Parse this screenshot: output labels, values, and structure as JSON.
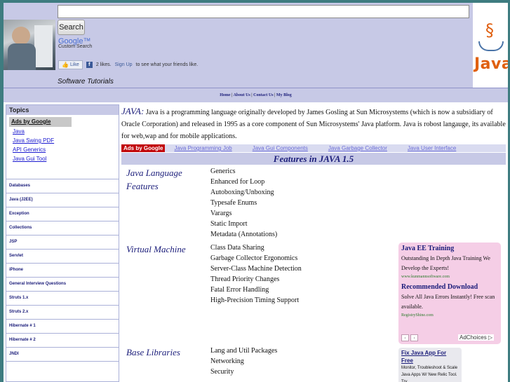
{
  "header": {
    "search_placeholder": "",
    "search_button": "Search",
    "google_brand": "Google™",
    "custom_search": "Custom Search",
    "fb_like": "Like",
    "fb_likes_text": "2 likes.",
    "fb_signup": "Sign Up",
    "fb_suffix": "to see what your friends like.",
    "tagline": "Software Tutorials",
    "logo_text": "Java"
  },
  "nav": {
    "home": "Home",
    "about": "About Us",
    "contact": "Contact Us",
    "blog": "My Blog",
    "sep": "|"
  },
  "sidebar": {
    "heading": "Topics",
    "ads_label": "Ads by Google",
    "ad_links": [
      "Java",
      "Java Swing PDF",
      "API Generics",
      "Java Gui Tool"
    ],
    "items": [
      "Databases",
      "Java (J2EE)",
      "Exception",
      "Collections",
      "JSP",
      "Servlet",
      "iPhone",
      "General Interview Questions",
      "Struts 1.x",
      "Struts 2.x",
      "Hibernate # 1",
      "Hibernate # 2",
      "JNDI"
    ]
  },
  "intro": {
    "java_label": "JAVA:",
    "text": " Java is a programming language originally developed by James Gosling at Sun Microsystems (which is now a subsidiary of Oracle Corporation) and released in 1995 as a core component of Sun Microsystems' Java platform. Java is robost langauge, its available for web,wap and for mobile applications."
  },
  "ad_strip": {
    "badge": "Ads by Google",
    "links": [
      "Java Programming Job",
      "Java Gui Components",
      "Java Garbage Collector",
      "Java User Interface"
    ]
  },
  "features_title": "Features in JAVA 1.5",
  "sections": [
    {
      "title": "Java Language Features",
      "items": [
        "Generics",
        "Enhanced for Loop",
        "Autoboxing/Unboxing",
        "Typesafe Enums",
        "Varargs",
        "Static Import",
        "Metadata (Annotations)"
      ]
    },
    {
      "title": "Virtual Machine",
      "items": [
        "Class Data Sharing",
        "Garbage Collector Ergonomics",
        "Server-Class Machine Detection",
        "Thread Priority Changes",
        "Fatal Error Handling",
        "High-Precision Timing Support"
      ]
    },
    {
      "title": "Base Libraries",
      "items": [
        "Lang and Util Packages",
        "Networking",
        "Security"
      ]
    }
  ],
  "ad_box1": {
    "title1": "Java EE Training",
    "text1": "Outstanding In Depth Java Training We Develop the Experts!",
    "url1": "www.kunmannsoftware.com",
    "title2": "Recommended Download",
    "text2": "Solve All Java Errors Instantly! Free scan available.",
    "url2": "RegistryShine.com",
    "prev": "‹",
    "next": "›",
    "adchoices": "AdChoices ▷"
  },
  "ad_box2": {
    "title": "Fix Java App For Free",
    "text": "Monitor, Troubleshoot & Scale Java Apps W/ New Relic Tool. Try"
  }
}
